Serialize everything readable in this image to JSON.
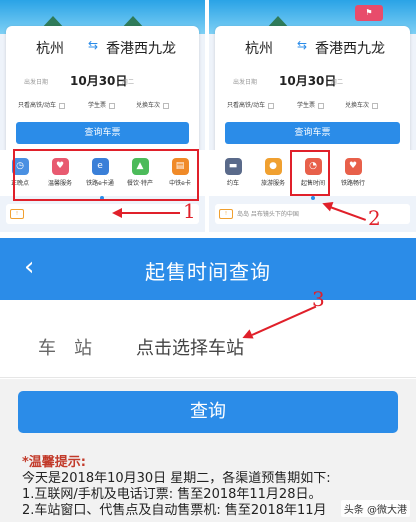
{
  "colors": {
    "primary": "#2b8ce8",
    "annotation": "#e0202a",
    "tip_heading": "#c23a2a"
  },
  "top_left": {
    "from": "杭州",
    "to": "香港西九龙",
    "date_label": "出发日期",
    "date": "10月30日",
    "weekday": "周二",
    "options": [
      "只看高铁/动车",
      "学生票",
      "兑换车次"
    ],
    "query_button": "查询车票",
    "icons": [
      {
        "label": "正晚点",
        "icon": "clock-icon",
        "color": "#4a90e2"
      },
      {
        "label": "温馨服务",
        "icon": "heart-icon",
        "color": "#e85a70"
      },
      {
        "label": "铁路e卡通",
        "icon": "card-icon",
        "color": "#3a7fd8"
      },
      {
        "label": "餐饮·特产",
        "icon": "food-icon",
        "color": "#4cbb5a"
      },
      {
        "label": "中铁e卡",
        "icon": "ecard-icon",
        "color": "#f08a28"
      }
    ],
    "annotation_number": "1"
  },
  "top_right": {
    "from": "杭州",
    "to": "香港西九龙",
    "date_label": "出发日期",
    "date": "10月30日",
    "weekday": "周二",
    "options": [
      "只看高铁/动车",
      "学生票",
      "兑换车次"
    ],
    "query_button": "查询车票",
    "icons": [
      {
        "label": "约车",
        "icon": "car-icon",
        "color": "#5a6a8a"
      },
      {
        "label": "旅游服务",
        "icon": "bulb-icon",
        "color": "#f0a030"
      },
      {
        "label": "起售时间",
        "icon": "time-icon",
        "color": "#e8604a"
      },
      {
        "label": "铁路畅行",
        "icon": "heart-icon",
        "color": "#e8604a"
      }
    ],
    "notice_text": "岛岛 吕布镜头下的中国",
    "annotation_number": "2"
  },
  "page": {
    "title": "起售时间查询",
    "station_label": "车站",
    "station_placeholder": "点击选择车站",
    "query_button": "查询",
    "annotation_number": "3",
    "tips": {
      "heading": "*温馨提示:",
      "lines": [
        "今天是2018年10月30日 星期二，各渠道预售期如下:",
        "1.互联网/手机及电话订票: 售至2018年11月28日。",
        "2.车站窗口、代售点及自动售票机: 售至2018年11月"
      ]
    }
  },
  "watermark": "头条 @微大港"
}
